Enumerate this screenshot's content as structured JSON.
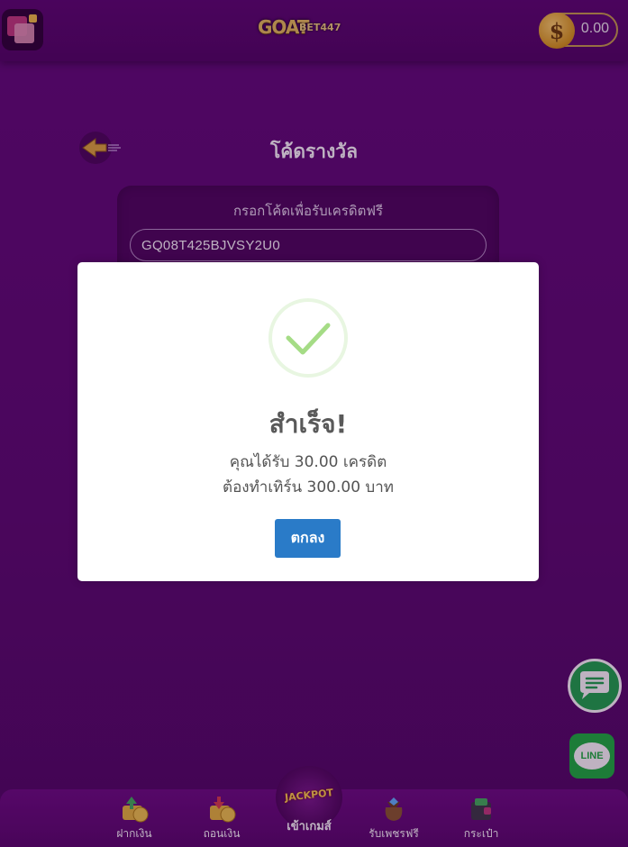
{
  "header": {
    "logo_main": "GOAT",
    "logo_sub": "BET447",
    "wallet_balance": "0.00",
    "coin_symbol": "$"
  },
  "page": {
    "title": "โค้ดรางวัล",
    "redeem_label": "กรอกโค้ดเพื่อรับเครดิตฟรี",
    "code_value": "GQ08T425BJVSY2U0"
  },
  "modal": {
    "title": "สำเร็จ!",
    "line1": "คุณได้รับ 30.00 เครดิต",
    "line2": "ต้องทำเทิร์น 300.00 บาท",
    "confirm_label": "ตกลง"
  },
  "side_buttons": {
    "line_label": "LINE"
  },
  "bottom_nav": {
    "deposit": "ฝากเงิน",
    "withdraw": "ถอนเงิน",
    "jackpot_badge": "JACKPOT",
    "play": "เข้าเกมส์",
    "free_diamonds": "รับเพชรฟรี",
    "wallet": "กระเป๋า"
  },
  "colors": {
    "background": "#5b0a70",
    "success_check": "#a5dc86",
    "confirm_button": "#2a7bc8",
    "chat_button": "#1aa64a",
    "line_button": "#19b23b"
  }
}
